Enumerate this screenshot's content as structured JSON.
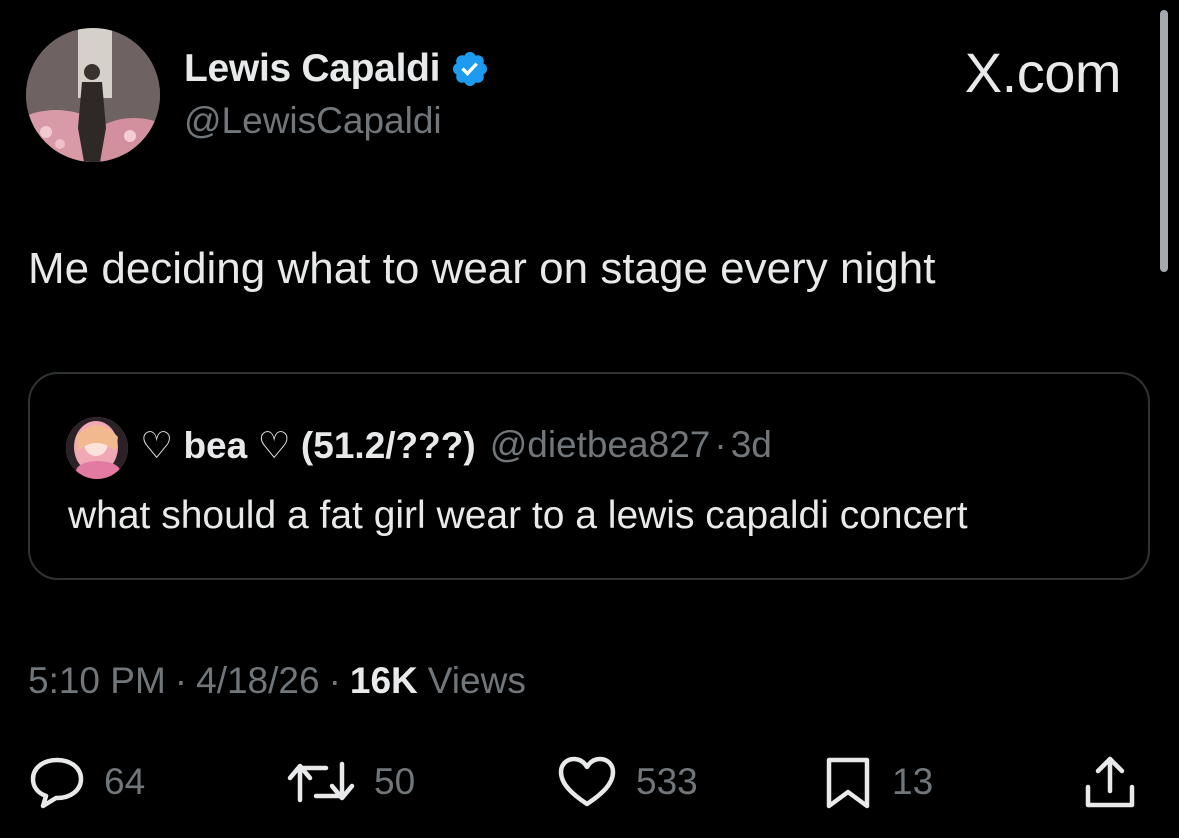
{
  "author": {
    "name": "Lewis Capaldi",
    "handle": "@LewisCapaldi",
    "verified_color": "#1d9bf0"
  },
  "site": {
    "label": "X.com"
  },
  "tweet": {
    "text": "Me deciding what to wear on stage every night"
  },
  "quote": {
    "name": "♡ bea ♡ (51.2/???)",
    "handle": "@dietbea827",
    "separator": "·",
    "time": "3d",
    "text": "what should a fat girl wear to a lewis capaldi concert"
  },
  "meta": {
    "time": "5:10 PM",
    "date": "4/18/26",
    "separator": "·",
    "views_count": "16K",
    "views_label": "Views"
  },
  "actions": {
    "reply": {
      "icon": "reply-icon",
      "count": "64"
    },
    "repost": {
      "icon": "repost-icon",
      "count": "50"
    },
    "like": {
      "icon": "heart-icon",
      "count": "533"
    },
    "bookmark": {
      "icon": "bookmark-icon",
      "count": "13"
    },
    "share": {
      "icon": "share-icon"
    }
  },
  "colors": {
    "background": "#000000",
    "text": "#e7e9ea",
    "secondary_text": "#71767b",
    "border": "#2f3336"
  }
}
